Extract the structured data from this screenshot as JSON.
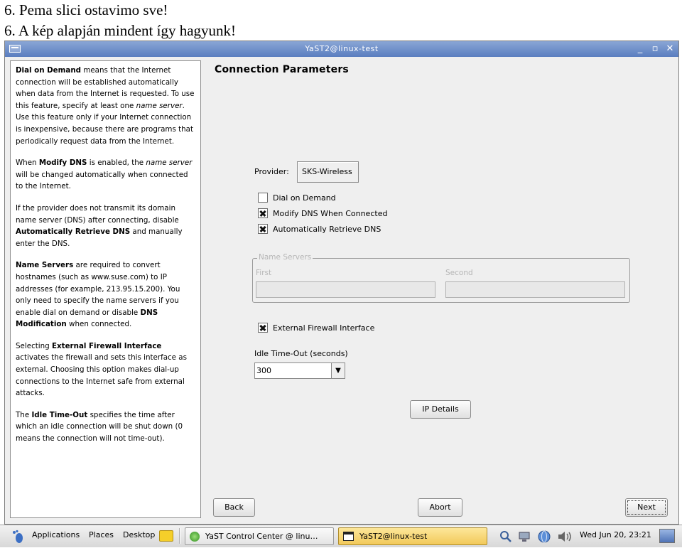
{
  "captions": {
    "line1": "6. Pema slici ostavimo sve!",
    "line2": "6. A kép alapján mindent így hagyunk!"
  },
  "window": {
    "title": "YaST2@linux-test",
    "buttons": {
      "minimize": "_",
      "maximize": "▫",
      "close": "✕"
    }
  },
  "help": {
    "p1": [
      {
        "t": "Dial on Demand",
        "s": "b"
      },
      {
        "t": " means that the Internet connection will be established automatically when data from the Internet is requested. To use this feature, specify at least one "
      },
      {
        "t": "name server",
        "s": "i"
      },
      {
        "t": ". Use this feature only if your Internet connection is inexpensive, because there are programs that periodically request data from the Internet."
      }
    ],
    "p2": [
      {
        "t": "When "
      },
      {
        "t": "Modify DNS",
        "s": "b"
      },
      {
        "t": " is enabled, the "
      },
      {
        "t": "name server",
        "s": "i"
      },
      {
        "t": " will be changed automatically when connected to the Internet."
      }
    ],
    "p3": [
      {
        "t": "If the provider does not transmit its domain name server (DNS) after connecting, disable "
      },
      {
        "t": "Automatically Retrieve DNS",
        "s": "b"
      },
      {
        "t": " and manually enter the DNS."
      }
    ],
    "p4": [
      {
        "t": "Name Servers",
        "s": "b"
      },
      {
        "t": " are required to convert hostnames (such as www.suse.com) to IP addresses (for example, 213.95.15.200). You only need to specify the name servers if you enable dial on demand or disable "
      },
      {
        "t": "DNS Modification",
        "s": "b"
      },
      {
        "t": " when connected."
      }
    ],
    "p5": [
      {
        "t": "Selecting "
      },
      {
        "t": "External Firewall Interface",
        "s": "b"
      },
      {
        "t": " activates the firewall and sets this interface as external. Choosing this option makes dial-up connections to the Internet safe from external attacks."
      }
    ],
    "p6": [
      {
        "t": "The "
      },
      {
        "t": "Idle Time-Out",
        "s": "b"
      },
      {
        "t": " specifies the time after which an idle connection will be shut down (0 means the connection will not time-out)."
      }
    ]
  },
  "main": {
    "title": "Connection Parameters",
    "provider_label": "Provider:",
    "provider_value": "SKS-Wireless",
    "checkboxes": [
      {
        "label": "Dial on Demand",
        "checked": false
      },
      {
        "label": "Modify DNS When Connected",
        "checked": true
      },
      {
        "label": "Automatically Retrieve DNS",
        "checked": true
      }
    ],
    "name_servers": {
      "legend": "Name Servers",
      "first_label": "First",
      "second_label": "Second",
      "first_value": "",
      "second_value": ""
    },
    "firewall": {
      "label": "External Firewall Interface",
      "checked": true
    },
    "idle": {
      "label": "Idle Time-Out (seconds)",
      "value": "300"
    },
    "buttons": {
      "ip_details": "IP Details",
      "back": "Back",
      "abort": "Abort",
      "next": "Next"
    }
  },
  "taskbar": {
    "menus": [
      "Applications",
      "Places",
      "Desktop"
    ],
    "tasks": [
      {
        "label": "YaST Control Center @ linu…",
        "active": false
      },
      {
        "label": "YaST2@linux-test",
        "active": true
      }
    ],
    "clock": "Wed Jun 20, 23:21"
  },
  "colors": {
    "title_bar": "#5a7ec0",
    "window_bg": "#efefef",
    "active_task": "#f2c95a"
  }
}
